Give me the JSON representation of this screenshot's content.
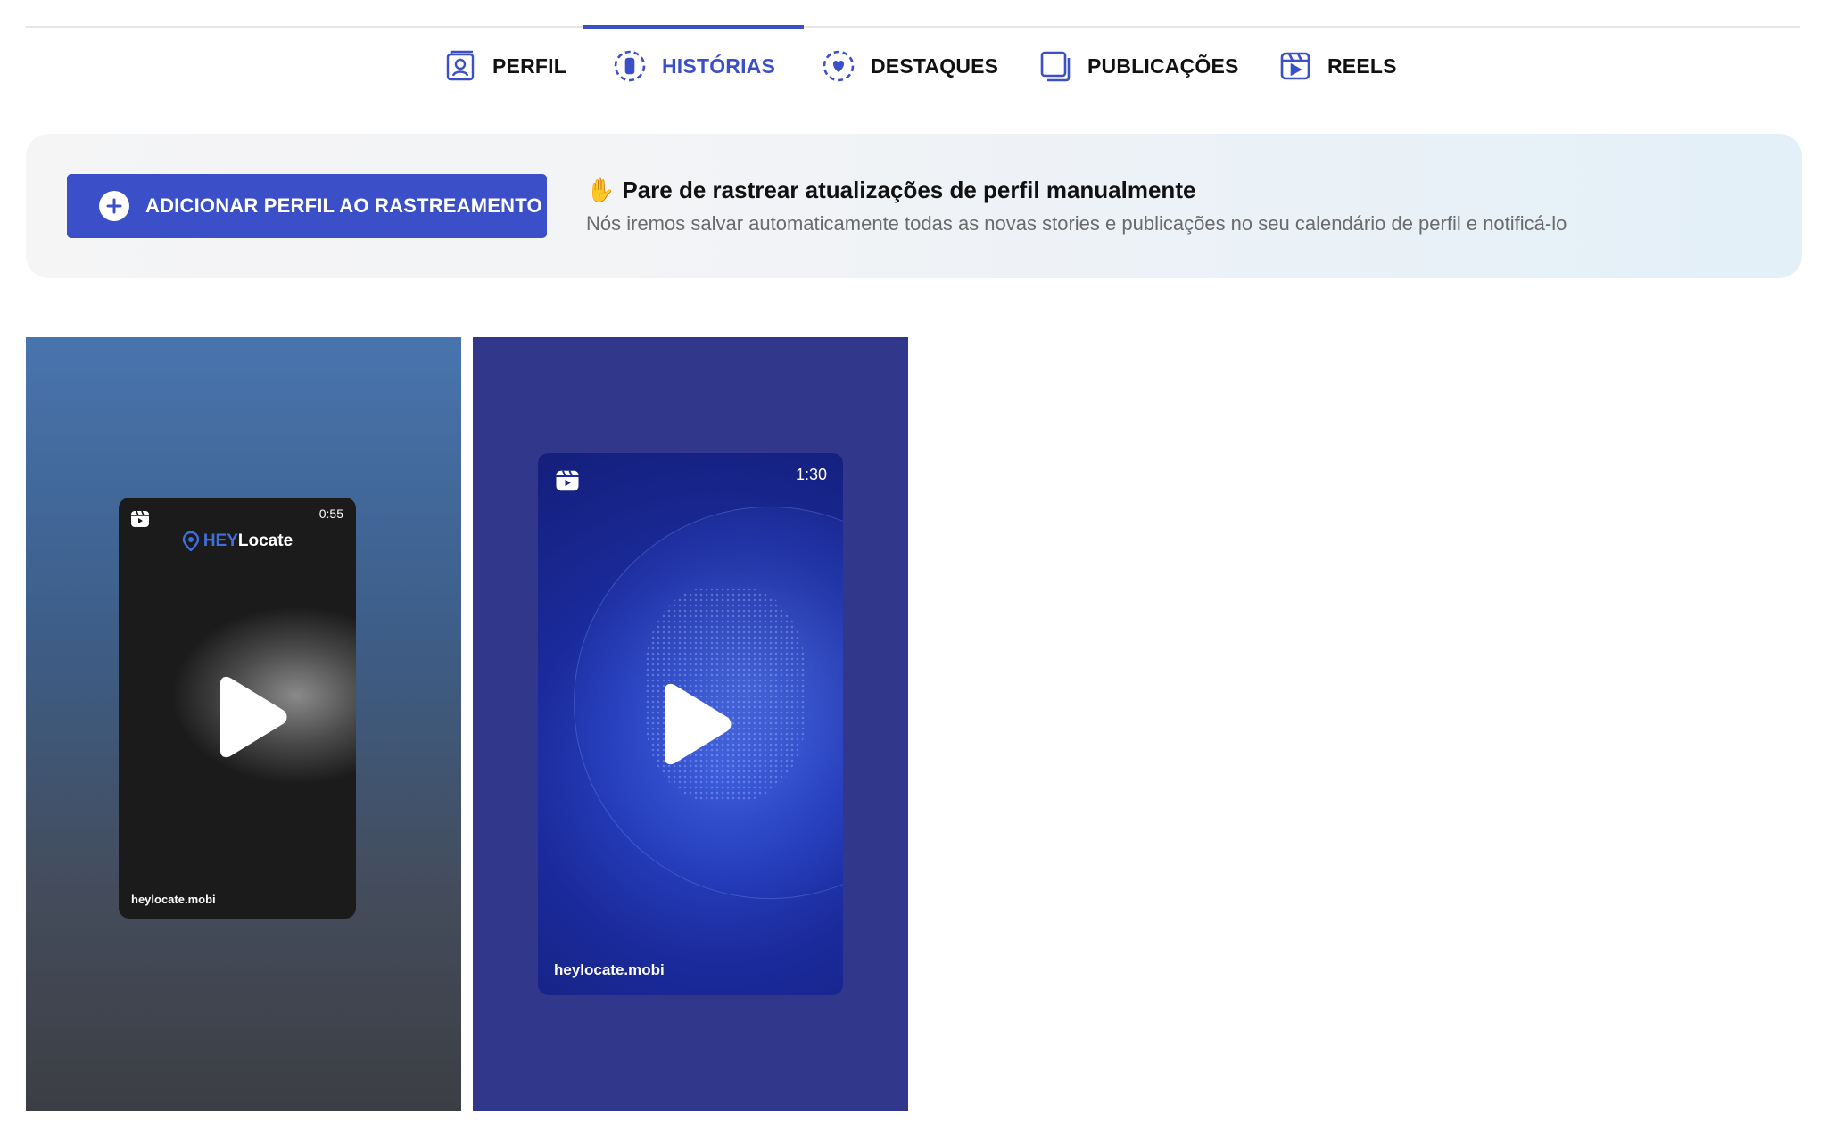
{
  "tabs": [
    {
      "label": "PERFIL",
      "icon": "profile-card-icon",
      "active": false
    },
    {
      "label": "HISTÓRIAS",
      "icon": "stories-circle-icon",
      "active": true
    },
    {
      "label": "DESTAQUES",
      "icon": "highlights-heart-icon",
      "active": false
    },
    {
      "label": "PUBLICAÇÕES",
      "icon": "posts-stack-icon",
      "active": false
    },
    {
      "label": "REELS",
      "icon": "reels-icon",
      "active": false
    }
  ],
  "banner": {
    "button_label": "ADICIONAR PERFIL AO RASTREAMENTO",
    "title_emoji": "✋",
    "title": "Pare de rastrear atualizações de perfil manualmente",
    "subtitle": "Nós iremos salvar automaticamente todas as novas stories e publicações no seu calendário de perfil e notificá-lo"
  },
  "stories": [
    {
      "duration": "0:55",
      "brand_hey": "HEY",
      "brand_rest": "Locate",
      "domain": "heylocate.mobi"
    },
    {
      "duration": "1:30",
      "domain": "heylocate.mobi"
    }
  ],
  "colors": {
    "accent": "#3a4fc8",
    "text": "#111111",
    "muted": "#6b6b6b"
  }
}
